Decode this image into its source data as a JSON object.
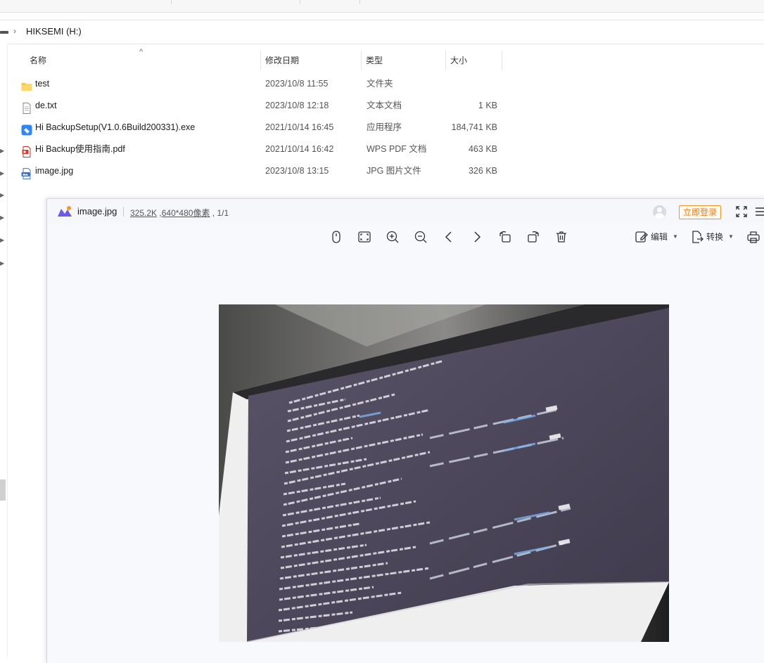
{
  "explorer": {
    "breadcrumb": "HIKSEMI (H:)",
    "columns": {
      "name": "名称",
      "date": "修改日期",
      "type": "类型",
      "size": "大小"
    },
    "files": [
      {
        "name": "test",
        "date": "2023/10/8 11:55",
        "type": "文件夹",
        "size": "",
        "icon": "folder-icon"
      },
      {
        "name": "de.txt",
        "date": "2023/10/8 12:18",
        "type": "文本文档",
        "size": "1 KB",
        "icon": "text-file-icon"
      },
      {
        "name": "Hi BackupSetup(V1.0.6Build200331).exe",
        "date": "2021/10/14 16:45",
        "type": "应用程序",
        "size": "184,741 KB",
        "icon": "exe-icon"
      },
      {
        "name": "Hi Backup使用指南.pdf",
        "date": "2021/10/14 16:42",
        "type": "WPS PDF 文档",
        "size": "463 KB",
        "icon": "pdf-icon"
      },
      {
        "name": "image.jpg",
        "date": "2023/10/8 13:15",
        "type": "JPG 图片文件",
        "size": "326 KB",
        "icon": "jpg-icon"
      }
    ]
  },
  "viewer": {
    "filename": "image.jpg",
    "file_size": "325.2K",
    "dimensions": ",640*480像素",
    "page_info": ", 1/1",
    "login_label": "立即登录",
    "edit_label": "编辑",
    "convert_label": "转换",
    "colors": {
      "accent_orange": "#ef7d14",
      "title_bar": "#f5f7fb",
      "canvas": "#f8f9fc"
    }
  }
}
